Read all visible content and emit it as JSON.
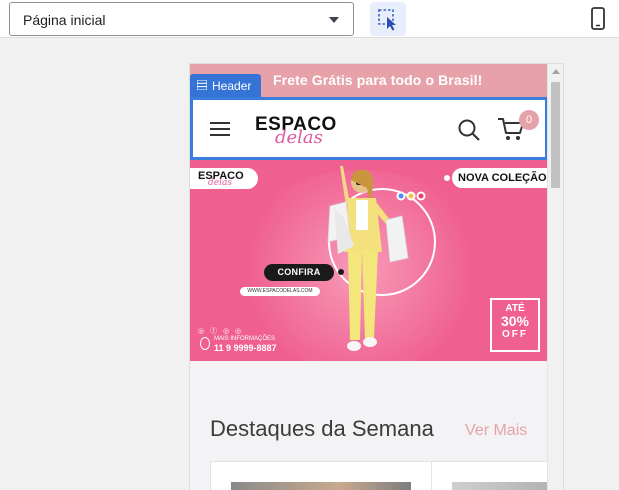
{
  "toolbar": {
    "page_select_value": "Página inicial",
    "select_tool_icon": "element-select-icon",
    "device_icon": "mobile-device-icon"
  },
  "preview": {
    "announcement": "Frete Grátis para todo o Brasil!",
    "header_tag_label": "Header",
    "logo": {
      "line1": "ESPACO",
      "line2": "delas"
    },
    "cart_count": "0",
    "hero": {
      "logo_line1": "ESPACO",
      "logo_line2": "delas",
      "collection_label": "NOVA COLEÇÃO",
      "cta_label": "CONFIRA",
      "website": "WWW.ESPACODELAS.COM",
      "more_info_label": "MAIS INFORMAÇÕES",
      "phone": "11 9 9999-8887",
      "promo_line1": "ATÉ",
      "promo_line2": "30%",
      "promo_line3": "OFF",
      "social_icons": "◎ ⓕ ◎ ◎"
    },
    "featured": {
      "title": "Destaques da Semana",
      "see_more": "Ver Mais"
    }
  },
  "colors": {
    "accent_pink": "#e6a2a8",
    "hero_pink": "#ef5f8f",
    "selection_blue": "#3b7ddd"
  }
}
